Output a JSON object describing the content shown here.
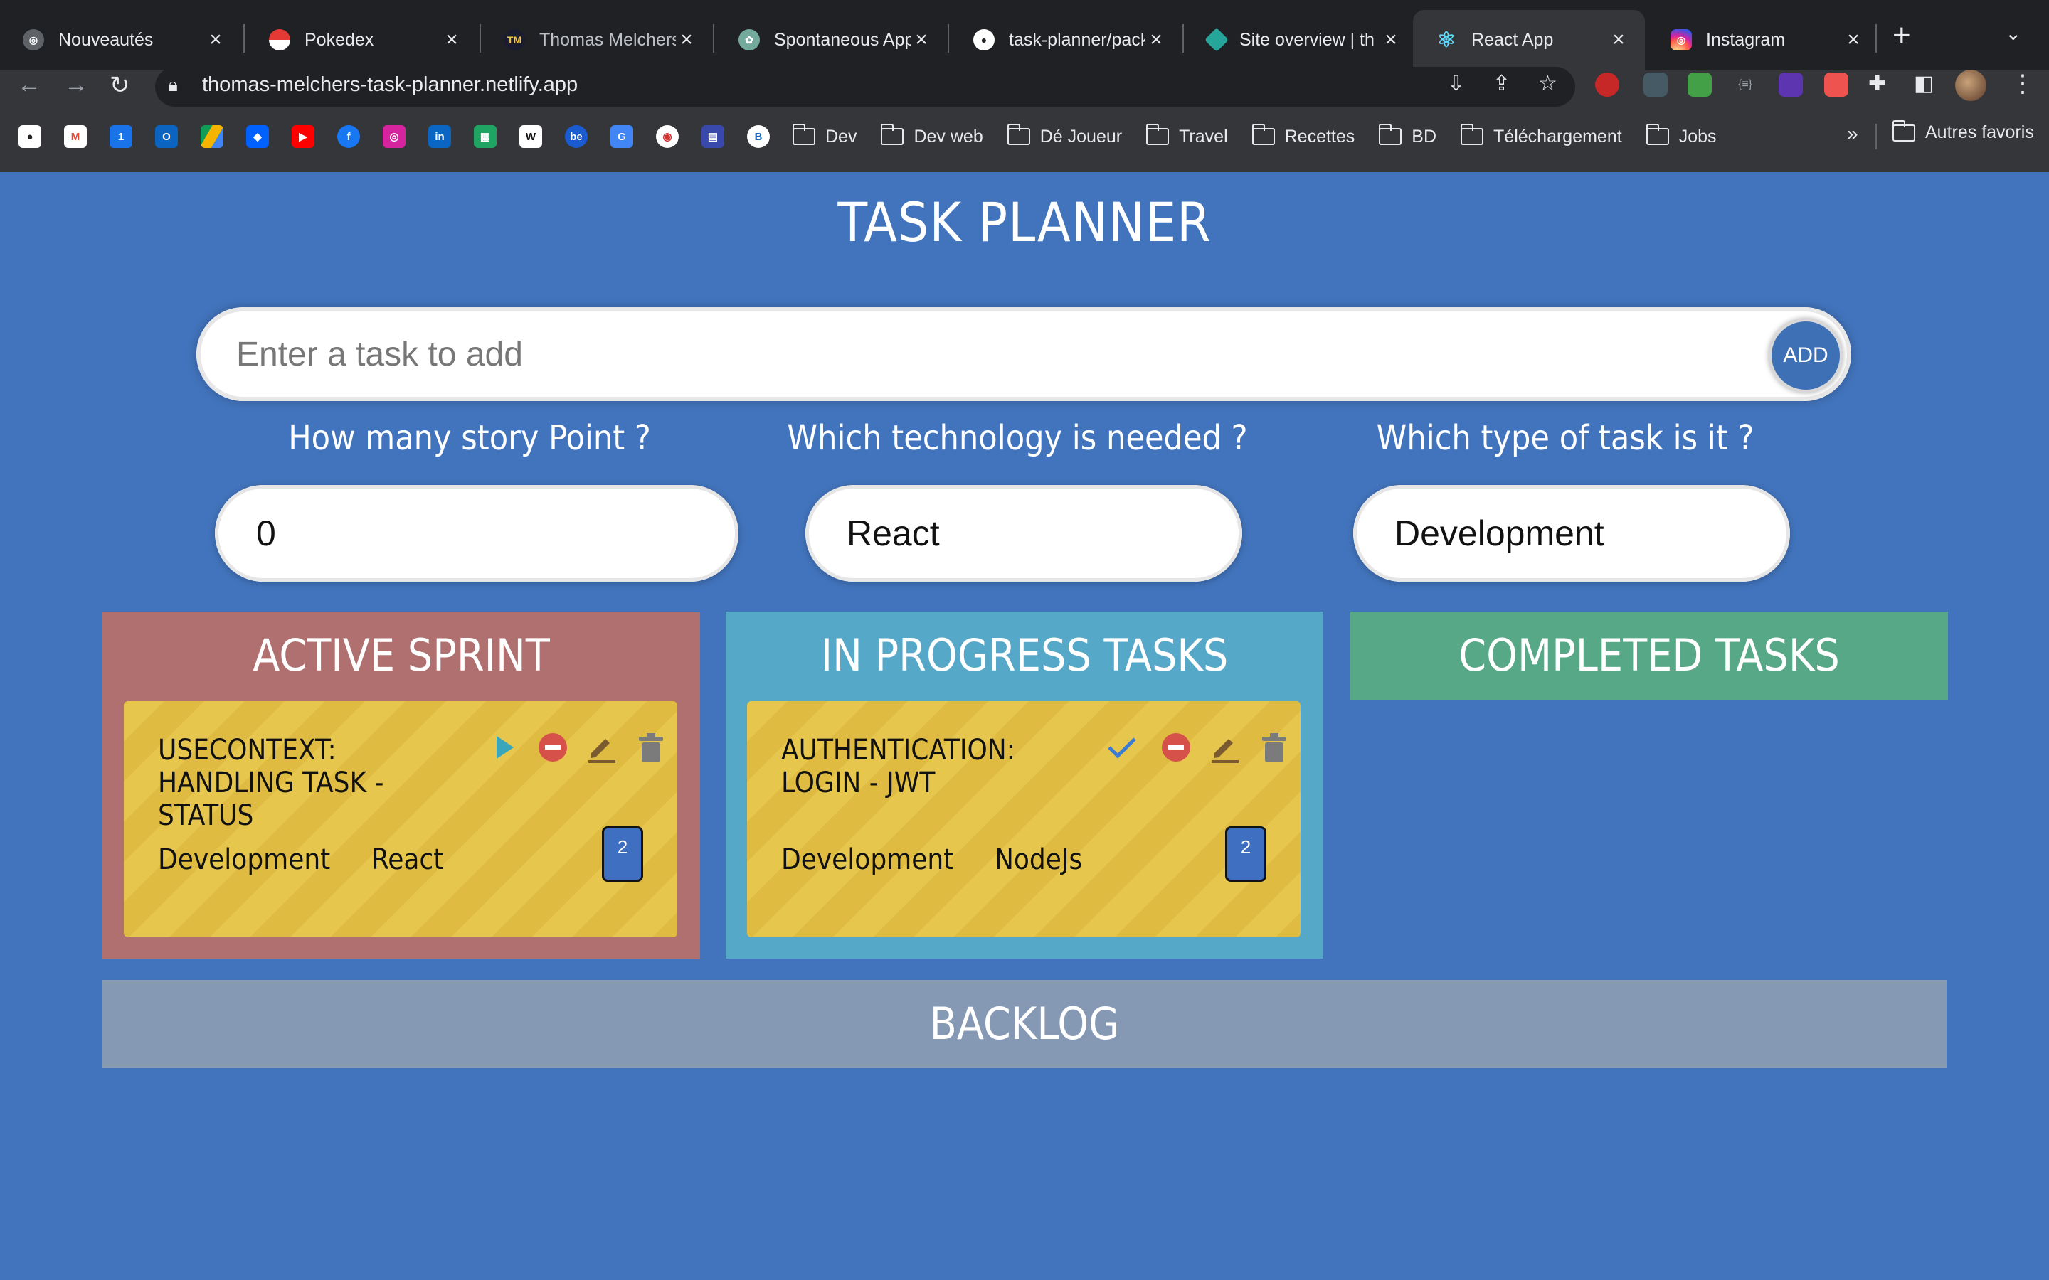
{
  "browser": {
    "tabs": [
      {
        "title": "Nouveautés",
        "active": false,
        "favicon": "chrome-icon",
        "favcolor": "#5f6368"
      },
      {
        "title": "Pokedex",
        "active": false,
        "favicon": "pokeball-icon",
        "favcolor": "#e53935"
      },
      {
        "title": "Thomas Melchers",
        "active": false,
        "favicon": "tm-icon",
        "favcolor": "#1b1b2f"
      },
      {
        "title": "Spontaneous App",
        "active": false,
        "favicon": "openai-icon",
        "favcolor": "#74aa9c"
      },
      {
        "title": "task-planner/pack",
        "active": false,
        "favicon": "github-icon",
        "favcolor": "#ffffff"
      },
      {
        "title": "Site overview | th",
        "active": false,
        "favicon": "netlify-icon",
        "favcolor": "#26a69a"
      },
      {
        "title": "React App",
        "active": true,
        "favicon": "react-icon",
        "favcolor": "#61dafb"
      },
      {
        "title": "Instagram",
        "active": false,
        "favicon": "instagram-icon",
        "favcolor": "#d6249f"
      }
    ],
    "url": "thomas-melchers-task-planner.netlify.app",
    "bookmark_folders": [
      "Dev",
      "Dev web",
      "Dé Joueur",
      "Travel",
      "Recettes",
      "BD",
      "Téléchargement",
      "Jobs"
    ],
    "bookmark_more": "»",
    "other_bookmarks": "Autres favoris"
  },
  "app": {
    "title": "TASK PLANNER",
    "task_input": {
      "placeholder": "Enter a task to add",
      "value": ""
    },
    "add_label": "ADD",
    "questions": {
      "story_points": {
        "label": "How many story Point ?",
        "value": "0"
      },
      "technology": {
        "label": "Which technology is needed ?",
        "value": "React"
      },
      "task_type": {
        "label": "Which type of task is it ?",
        "value": "Development"
      }
    },
    "columns": {
      "active": {
        "title": "ACTIVE SPRINT",
        "color": "#b07070",
        "card": {
          "title": "USECONTEXT: HANDLING TASK - STATUS",
          "type": "Development",
          "tech": "React",
          "points": "2"
        }
      },
      "progress": {
        "title": "IN PROGRESS TASKS",
        "color": "#56a8c8",
        "card": {
          "title": "AUTHENTICATION: LOGIN - JWT",
          "type": "Development",
          "tech": "NodeJs",
          "points": "2"
        }
      },
      "completed": {
        "title": "COMPLETED TASKS",
        "color": "#57a887"
      }
    },
    "backlog": {
      "title": "BACKLOG",
      "color": "#8598b4"
    },
    "colors": {
      "background": "#4274bd",
      "card": "#e6c243",
      "points_badge": "#3f6fc0"
    }
  }
}
